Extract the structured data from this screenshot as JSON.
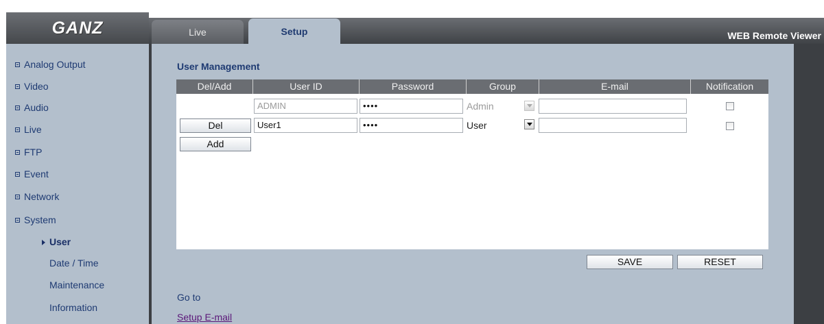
{
  "header": {
    "logo_text": "GANZ",
    "app_title": "WEB Remote Viewer",
    "tabs": [
      {
        "label": "Live",
        "active": false
      },
      {
        "label": "Setup",
        "active": true
      }
    ]
  },
  "sidebar": {
    "items": [
      {
        "label": "Analog Output"
      },
      {
        "label": "Video"
      },
      {
        "label": "Audio"
      },
      {
        "label": "Live"
      },
      {
        "label": "FTP"
      },
      {
        "label": "Event"
      },
      {
        "label": "Network"
      },
      {
        "label": "System"
      }
    ],
    "subitems": [
      {
        "label": "User",
        "active": true
      },
      {
        "label": "Date / Time",
        "active": false
      },
      {
        "label": "Maintenance",
        "active": false
      },
      {
        "label": "Information",
        "active": false
      }
    ]
  },
  "user_management": {
    "title": "User Management",
    "columns": [
      "Del/Add",
      "User ID",
      "Password",
      "Group",
      "E-mail",
      "Notification"
    ],
    "rows": [
      {
        "user_id": "ADMIN",
        "password": "••••",
        "group": "Admin",
        "email": "",
        "notification": false,
        "editable": false
      },
      {
        "del_label": "Del",
        "user_id": "User1",
        "password": "••••",
        "group": "User",
        "email": "",
        "notification": false,
        "editable": true
      }
    ],
    "add_label": "Add",
    "save_label": "SAVE",
    "reset_label": "RESET"
  },
  "goto": {
    "label": "Go to",
    "link_text": "Setup E-mail"
  },
  "colors": {
    "frame_bg": "#b3bfcc",
    "header_dark": "#45484c",
    "accent_text": "#1e3a72",
    "link": "#5b1779"
  }
}
